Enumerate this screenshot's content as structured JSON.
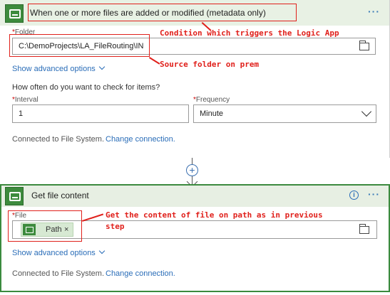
{
  "trigger": {
    "title": "When one or more files are added or modified (metadata only)",
    "folder_label": "Folder",
    "folder_value": "C:\\DemoProjects\\LA_FileRouting\\IN",
    "advanced_label": "Show advanced options",
    "question": "How often do you want to check for items?",
    "interval_label": "Interval",
    "interval_value": "1",
    "frequency_label": "Frequency",
    "frequency_value": "Minute",
    "connected_text": "Connected to File System.",
    "change_connection": "Change connection."
  },
  "action": {
    "title": "Get file content",
    "file_label": "File",
    "token_label": "Path",
    "token_remove": "×",
    "advanced_label": "Show advanced options",
    "connected_text": "Connected to File System.",
    "change_connection": "Change connection."
  },
  "annotations": {
    "trigger_note": "Condition which triggers the Logic App",
    "source_note": "Source folder on prem",
    "content_note_line1": "Get the content of file on path as in previous",
    "content_note_line2": "step"
  },
  "ui": {
    "required_mark": "*",
    "more_glyph": "···",
    "plus_glyph": "+",
    "info_glyph": "i"
  },
  "colors": {
    "connector_green": "#3d8b3d",
    "header_bg": "#e8f1e4",
    "link_blue": "#2a6db8",
    "annotation_red": "#e0201b"
  }
}
